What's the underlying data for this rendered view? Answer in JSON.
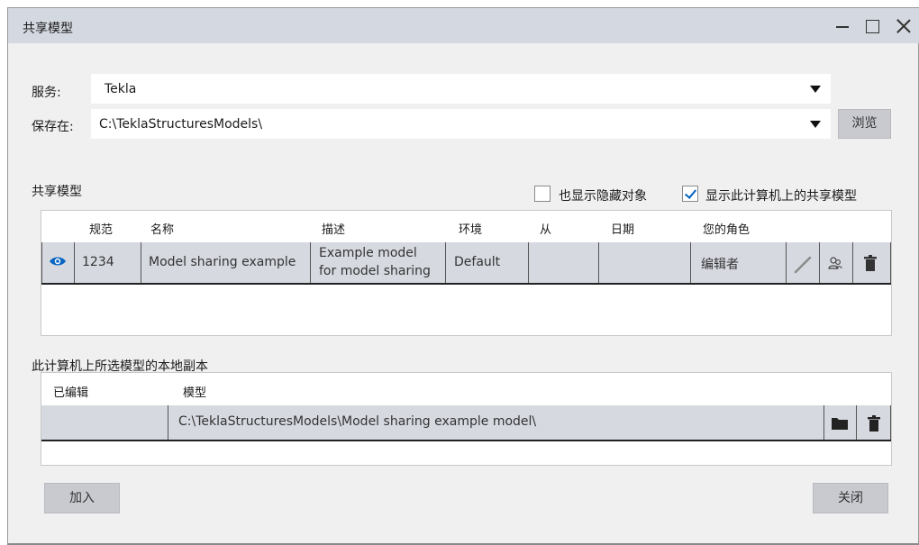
{
  "window": {
    "title": "共享模型"
  },
  "service": {
    "label": "服务:",
    "value": "Tekla"
  },
  "save": {
    "label": "保存在:",
    "value": "C:\\TeklaStructuresModels\\",
    "browse": "浏览"
  },
  "shared": {
    "title": "共享模型",
    "show_hidden": {
      "label": "也显示隐藏对象",
      "checked": false
    },
    "show_local": {
      "label": "显示此计算机上的共享模型",
      "checked": true
    },
    "columns": [
      "规范",
      "名称",
      "描述",
      "环境",
      "从",
      "日期",
      "您的角色"
    ],
    "rows": [
      {
        "code": "1234",
        "name": "Model sharing example",
        "desc_line1": "Example model",
        "desc_line2": "for model sharing",
        "env": "Default",
        "from": "",
        "date": "",
        "role": "编辑者"
      }
    ]
  },
  "local": {
    "title": "此计算机上所选模型的本地副本",
    "columns": [
      "已编辑",
      "模型"
    ],
    "rows": [
      {
        "edited": "",
        "path": "C:\\TeklaStructuresModels\\Model sharing example model\\"
      }
    ]
  },
  "footer": {
    "add": "加入",
    "close": "关闭"
  },
  "colors": {
    "accent": "#0060c0",
    "row_bg": "#d6d9e0",
    "titlebar": "#d4d8e0"
  },
  "icons": [
    "eye-icon",
    "pencil-icon",
    "users-icon",
    "trash-icon",
    "folder-icon",
    "dropdown-arrow-icon",
    "checkmark-icon"
  ]
}
